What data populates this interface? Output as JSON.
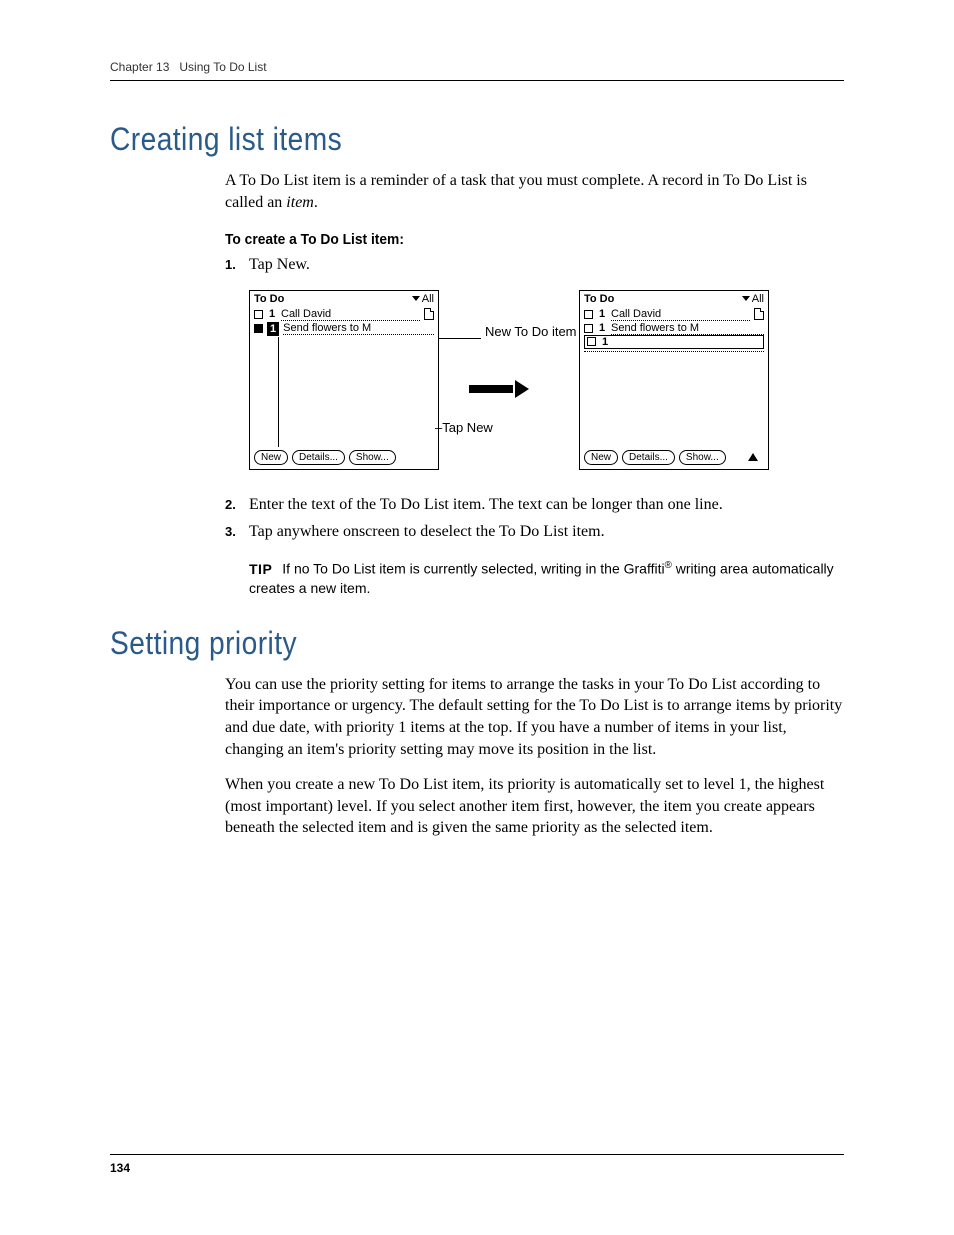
{
  "header": {
    "chapter_label": "Chapter 13",
    "chapter_title": "Using To Do List"
  },
  "section1": {
    "heading": "Creating list items",
    "intro_a": "A To Do List item is a reminder of a task that you must complete. A record in To Do List is called an ",
    "intro_italic": "item",
    "intro_b": ".",
    "subheading": "To create a To Do List item:",
    "step1": "Tap New.",
    "step2": "Enter the text of the To Do List item. The text can be longer than one line.",
    "step3": "Tap anywhere onscreen to deselect the To Do List item.",
    "tip_label": "TIP",
    "tip_a": "If no To Do List item is currently selected, writing in the Graffiti",
    "tip_reg": "®",
    "tip_b": " writing area automatically creates a new item."
  },
  "section2": {
    "heading": "Setting priority",
    "p1": "You can use the priority setting for items to arrange the tasks in your To Do List according to their importance or urgency. The default setting for the To Do List is to arrange items by priority and due date, with priority 1 items at the top. If you have a number of items in your list, changing an item's priority setting may move its position in the list.",
    "p2": "When you create a new To Do List item, its priority is automatically set to level 1, the highest (most important) level. If you select another item first, however, the item you create appears beneath the selected item and is given the same priority as the selected item."
  },
  "figure": {
    "app_title": "To Do",
    "category": "All",
    "item1": "Call David",
    "item2": "Send flowers to M",
    "priority1": "1",
    "btn_new": "New",
    "btn_details": "Details...",
    "btn_show": "Show...",
    "callout_new_item": "New To Do item",
    "callout_tap_new": "Tap New"
  },
  "footer": {
    "page_number": "134"
  }
}
